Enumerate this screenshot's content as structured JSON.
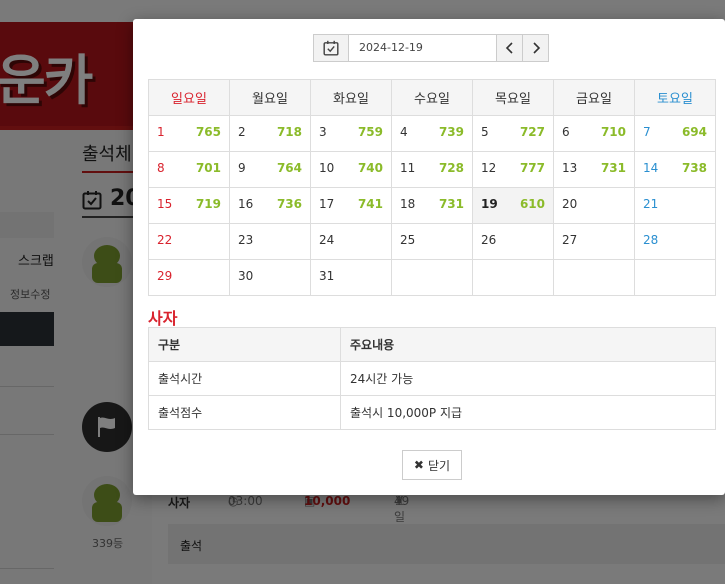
{
  "background": {
    "banner_text": "운카",
    "title": "출석체",
    "year_prefix": "20",
    "scrap_label": "스크랩",
    "edit_info_label": "정보수정",
    "rank": "339등",
    "row": {
      "name": "사자",
      "time": "03:00",
      "points": "10,000",
      "days": "49일"
    },
    "status_text": "출석"
  },
  "modal": {
    "date_value": "2024-12-19",
    "prev_icon": "chevron-left-icon",
    "next_icon": "chevron-right-icon",
    "calendar_icon": "calendar-check-icon",
    "weekdays": [
      "일요일",
      "월요일",
      "화요일",
      "수요일",
      "목요일",
      "금요일",
      "토요일"
    ],
    "weeks": [
      [
        {
          "d": "1",
          "c": "765"
        },
        {
          "d": "2",
          "c": "718"
        },
        {
          "d": "3",
          "c": "759"
        },
        {
          "d": "4",
          "c": "739"
        },
        {
          "d": "5",
          "c": "727"
        },
        {
          "d": "6",
          "c": "710"
        },
        {
          "d": "7",
          "c": "694"
        }
      ],
      [
        {
          "d": "8",
          "c": "701"
        },
        {
          "d": "9",
          "c": "764"
        },
        {
          "d": "10",
          "c": "740"
        },
        {
          "d": "11",
          "c": "728"
        },
        {
          "d": "12",
          "c": "777"
        },
        {
          "d": "13",
          "c": "731"
        },
        {
          "d": "14",
          "c": "738"
        }
      ],
      [
        {
          "d": "15",
          "c": "719"
        },
        {
          "d": "16",
          "c": "736"
        },
        {
          "d": "17",
          "c": "741"
        },
        {
          "d": "18",
          "c": "731"
        },
        {
          "d": "19",
          "c": "610"
        },
        {
          "d": "20",
          "c": ""
        },
        {
          "d": "21",
          "c": ""
        }
      ],
      [
        {
          "d": "22",
          "c": ""
        },
        {
          "d": "23",
          "c": ""
        },
        {
          "d": "24",
          "c": ""
        },
        {
          "d": "25",
          "c": ""
        },
        {
          "d": "26",
          "c": ""
        },
        {
          "d": "27",
          "c": ""
        },
        {
          "d": "28",
          "c": ""
        }
      ],
      [
        {
          "d": "29",
          "c": ""
        },
        {
          "d": "30",
          "c": ""
        },
        {
          "d": "31",
          "c": ""
        },
        {
          "d": "",
          "c": ""
        },
        {
          "d": "",
          "c": ""
        },
        {
          "d": "",
          "c": ""
        },
        {
          "d": "",
          "c": ""
        }
      ]
    ],
    "today": "19",
    "section_title": "사자",
    "info_headers": [
      "구분",
      "주요내용"
    ],
    "info_rows": [
      [
        "출석시간",
        "24시간 가능"
      ],
      [
        "출석점수",
        "출석시 10,000P 지급"
      ]
    ],
    "close_label": "닫기",
    "colors": {
      "sunday": "#d9232e",
      "saturday": "#2a8fd0",
      "count": "#8bbb2a"
    }
  }
}
